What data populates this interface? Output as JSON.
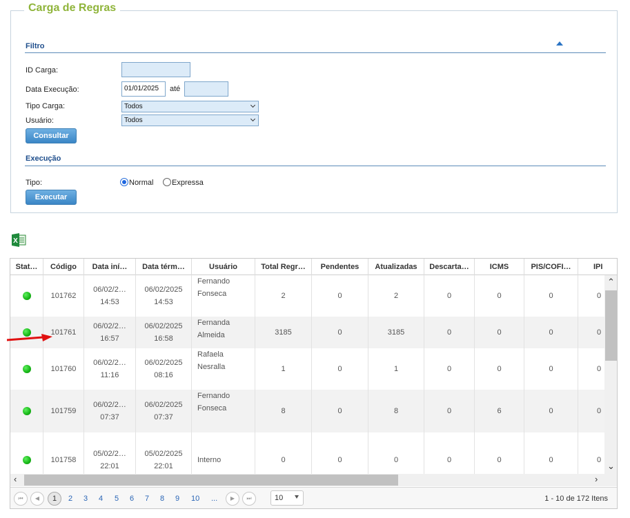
{
  "panel": {
    "title": "Carga de Regras",
    "filter": {
      "section_title": "Filtro",
      "id_carga_label": "ID Carga:",
      "id_carga_value": "",
      "data_execucao_label": "Data Execução:",
      "data_execucao_from": "01/01/2025",
      "ate_label": "até",
      "data_execucao_to": "",
      "tipo_carga_label": "Tipo Carga:",
      "tipo_carga_value": "Todos",
      "usuario_label": "Usuário:",
      "usuario_value": "Todos",
      "consultar_label": "Consultar"
    },
    "execucao": {
      "section_title": "Execução",
      "tipo_label": "Tipo:",
      "options": [
        "Normal",
        "Expressa"
      ],
      "selected": "Normal",
      "executar_label": "Executar"
    }
  },
  "grid": {
    "columns": [
      "Stat…",
      "Código",
      "Data iní…",
      "Data térm…",
      "Usuário",
      "Total Regr…",
      "Pendentes",
      "Atualizadas",
      "Descarta…",
      "ICMS",
      "PIS/COFI…",
      "IPI"
    ],
    "rows": [
      {
        "status": "green",
        "codigo": "101762",
        "inicio_date": "06/02/2…",
        "inicio_time": "14:53",
        "termino_date": "06/02/2025",
        "termino_time": "14:53",
        "usuario_1": "Fernando",
        "usuario_2": "Fonseca",
        "total": "2",
        "pendentes": "0",
        "atualizadas": "2",
        "descartadas": "0",
        "icms": "0",
        "pis": "0",
        "ipi": "0"
      },
      {
        "status": "green",
        "codigo": "101761",
        "inicio_date": "06/02/2…",
        "inicio_time": "16:57",
        "termino_date": "06/02/2025",
        "termino_time": "16:58",
        "usuario_1": "Fernanda",
        "usuario_2": "Almeida",
        "total": "3185",
        "pendentes": "0",
        "atualizadas": "3185",
        "descartadas": "0",
        "icms": "0",
        "pis": "0",
        "ipi": "0"
      },
      {
        "status": "green",
        "codigo": "101760",
        "inicio_date": "06/02/2…",
        "inicio_time": "11:16",
        "termino_date": "06/02/2025",
        "termino_time": "08:16",
        "usuario_1": "Rafaela",
        "usuario_2": "Nesralla",
        "total": "1",
        "pendentes": "0",
        "atualizadas": "1",
        "descartadas": "0",
        "icms": "0",
        "pis": "0",
        "ipi": "0"
      },
      {
        "status": "green",
        "codigo": "101759",
        "inicio_date": "06/02/2…",
        "inicio_time": "07:37",
        "termino_date": "06/02/2025",
        "termino_time": "07:37",
        "usuario_1": "Fernando",
        "usuario_2": "Fonseca",
        "total": "8",
        "pendentes": "0",
        "atualizadas": "8",
        "descartadas": "0",
        "icms": "6",
        "pis": "0",
        "ipi": "0"
      },
      {
        "status": "green",
        "codigo": "101758",
        "inicio_date": "05/02/2…",
        "inicio_time": "22:01",
        "termino_date": "05/02/2025",
        "termino_time": "22:01",
        "usuario_1": "Interno",
        "usuario_2": "",
        "total": "0",
        "pendentes": "0",
        "atualizadas": "0",
        "descartadas": "0",
        "icms": "0",
        "pis": "0",
        "ipi": "0"
      }
    ],
    "pager": {
      "pages": [
        "1",
        "2",
        "3",
        "4",
        "5",
        "6",
        "7",
        "8",
        "9",
        "10",
        "..."
      ],
      "current": "1",
      "page_size": "10",
      "info": "1 - 10 de 172 Itens"
    }
  },
  "colors": {
    "title_green": "#8fb43a",
    "section_blue": "#1f4e8c",
    "button_blue": "#3a86c6",
    "status_green": "#16b516",
    "annotation_red": "#e01010"
  }
}
